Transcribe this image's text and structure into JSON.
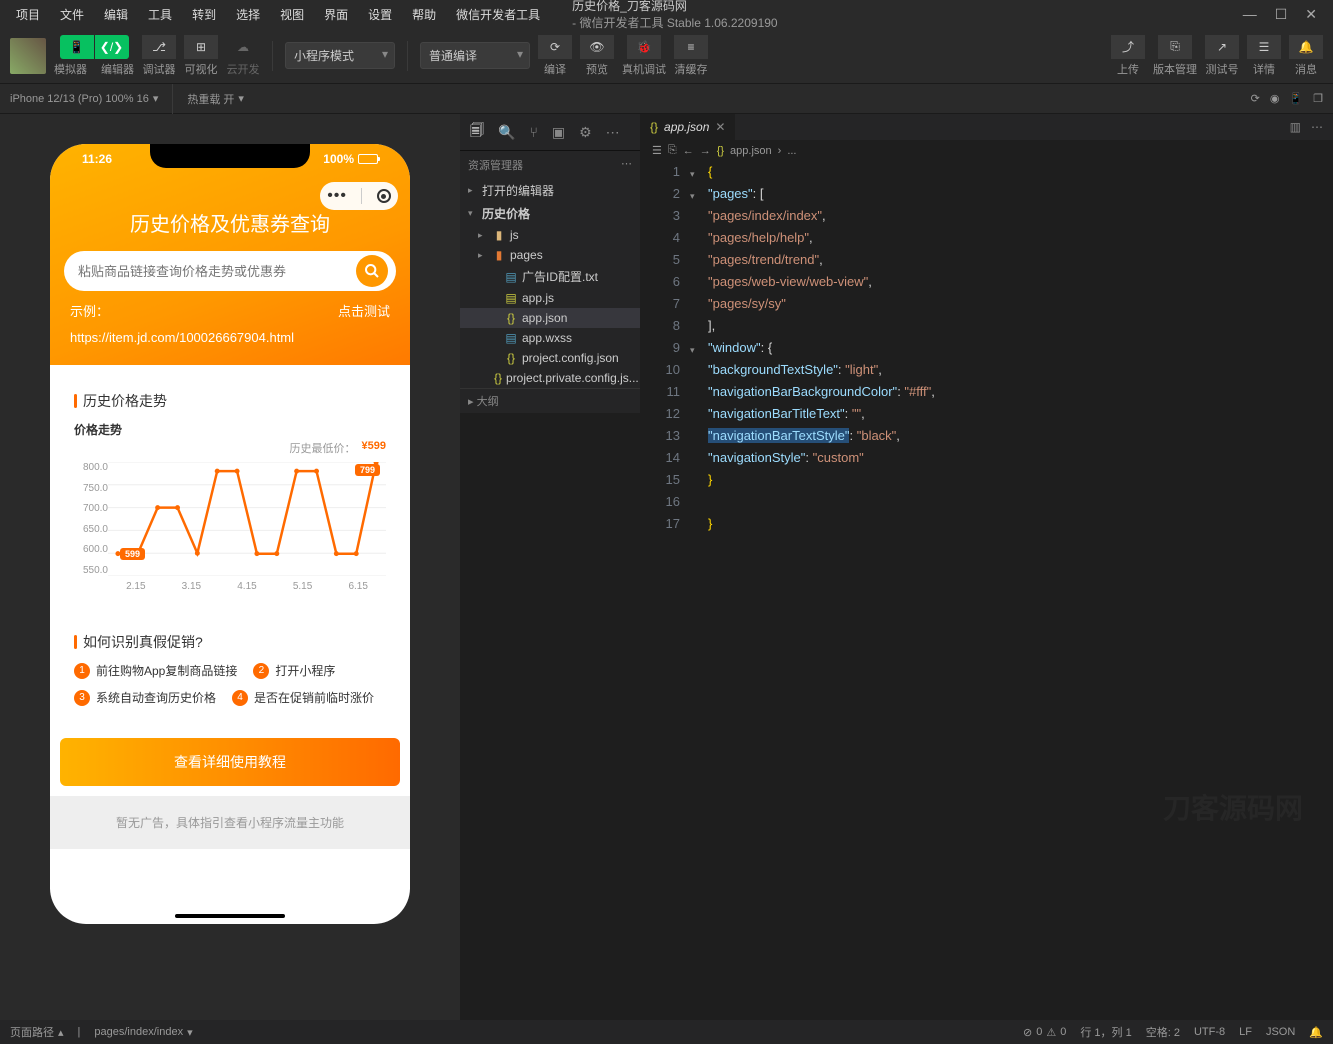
{
  "menu": [
    "项目",
    "文件",
    "编辑",
    "工具",
    "转到",
    "选择",
    "视图",
    "界面",
    "设置",
    "帮助",
    "微信开发者工具"
  ],
  "window_title_main": "历史价格_刀客源码网",
  "window_title_sub": " - 微信开发者工具 Stable 1.06.2209190",
  "toolbar": {
    "simulator": "模拟器",
    "editor": "编辑器",
    "debugger": "调试器",
    "visual": "可视化",
    "cloud": "云开发",
    "mode": "小程序模式",
    "compile_mode": "普通编译",
    "compile": "编译",
    "preview": "预览",
    "debug": "真机调试",
    "cache": "清缓存",
    "upload": "上传",
    "version": "版本管理",
    "testnum": "测试号",
    "detail": "详情",
    "message": "消息"
  },
  "device": {
    "name": "iPhone 12/13 (Pro) 100% 16",
    "hot": "热重载 开"
  },
  "phone": {
    "time": "11:26",
    "battery": "100%",
    "title": "历史价格及优惠券查询",
    "placeholder": "粘贴商品链接查询价格走势或优惠券",
    "example_label": "示例：",
    "example_btn": "点击测试",
    "example_url": "https://item.jd.com/100026667904.html",
    "sec1": "历史价格走势",
    "chart": {
      "title": "价格走势",
      "lowlabel": "历史最低价：",
      "lowprice": "¥599"
    },
    "sec2": "如何识别真假促销?",
    "steps": [
      "前往购物App复制商品链接",
      "打开小程序",
      "系统自动查询历史价格",
      "是否在促销前临时涨价"
    ],
    "bigbtn": "查看详细使用教程",
    "adtext": "暂无广告，具体指引查看小程序流量主功能"
  },
  "explorer": {
    "header": "资源管理器",
    "group_editors": "打开的编辑器",
    "group_project": "历史价格",
    "folders": {
      "js": "js",
      "pages": "pages"
    },
    "files": {
      "adtxt": "广告ID配置.txt",
      "appjs": "app.js",
      "appjson": "app.json",
      "appwxss": "app.wxss",
      "projconfig": "project.config.json",
      "projprivate": "project.private.config.js..."
    },
    "outline": "大纲"
  },
  "editor_tab": "app.json",
  "breadcrumb": [
    "app.json",
    "..."
  ],
  "code": {
    "pages": [
      "pages/index/index",
      "pages/help/help",
      "pages/trend/trend",
      "pages/web-view/web-view",
      "pages/sy/sy"
    ],
    "window": {
      "backgroundTextStyle": "light",
      "navigationBarBackgroundColor": "#fff",
      "navigationBarTitleText": "",
      "navigationBarTextStyle": "black",
      "navigationStyle": "custom"
    }
  },
  "status": {
    "path_label": "页面路径",
    "path": "pages/index/index",
    "err": "0",
    "warn": "0",
    "pos": "行 1，列 1",
    "spaces": "空格: 2",
    "enc": "UTF-8",
    "eol": "LF",
    "lang": "JSON"
  },
  "watermark": "刀客源码网",
  "chart_data": {
    "type": "line",
    "categories": [
      "2.15",
      "3.15",
      "4.15",
      "5.15",
      "6.15"
    ],
    "values": [
      599,
      599,
      700,
      700,
      600,
      780,
      780,
      599,
      599,
      780,
      780,
      599,
      599,
      799
    ],
    "title": "价格走势",
    "xlabel": "",
    "ylabel": "",
    "ylim": [
      550,
      800
    ],
    "annotations": [
      {
        "label": "599",
        "idx": 1
      },
      {
        "label": "799",
        "idx": 13
      }
    ]
  }
}
